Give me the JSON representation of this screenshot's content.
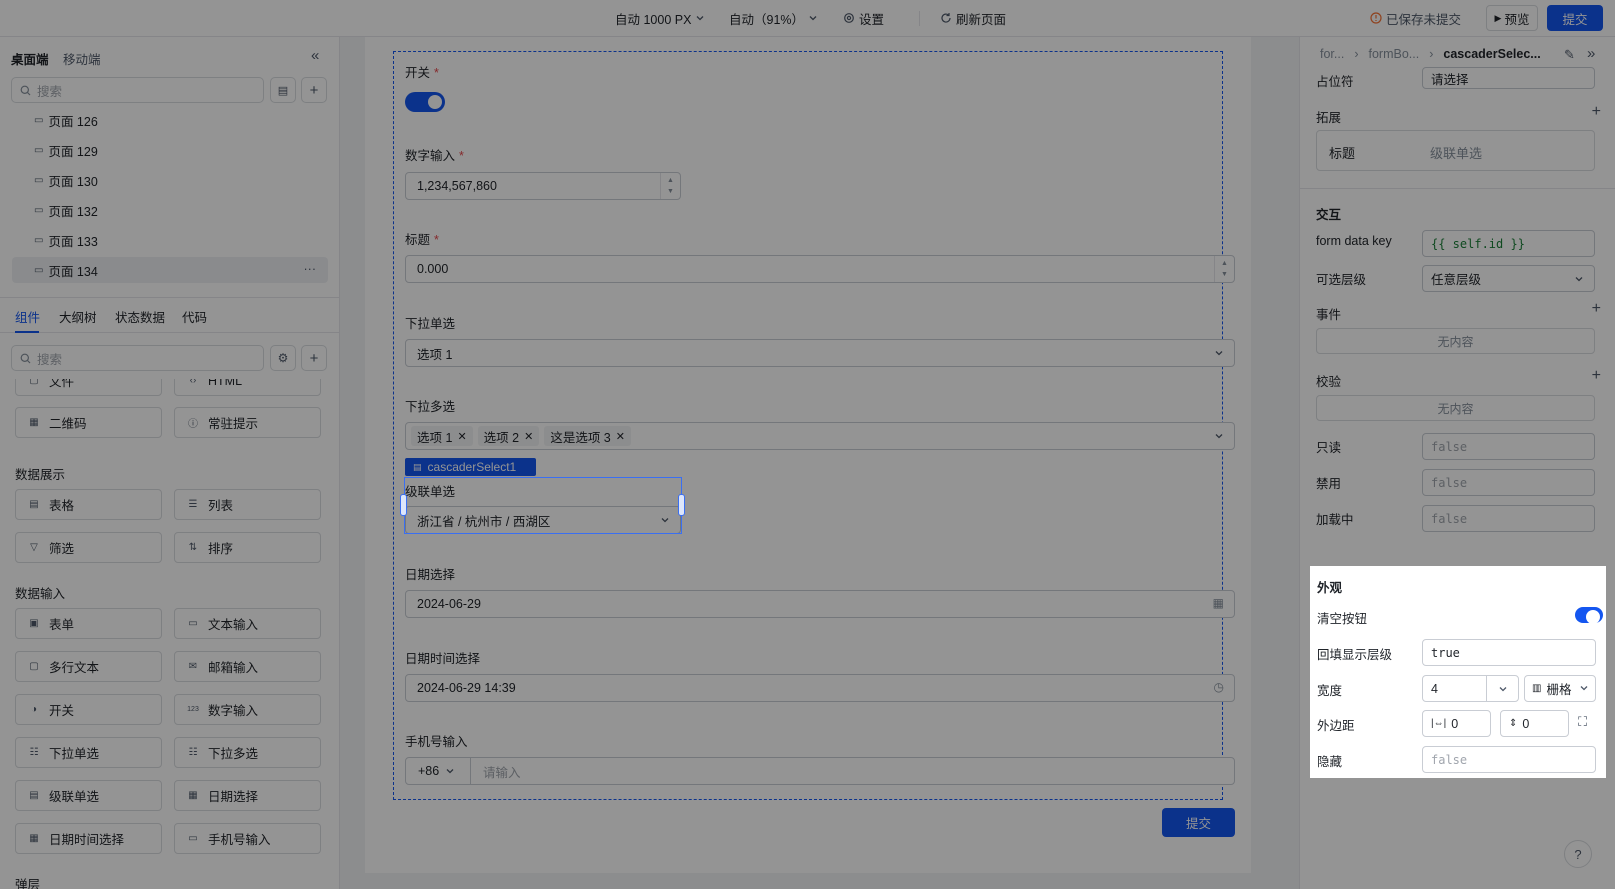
{
  "topbar": {
    "width_label": "自动 1000 PX",
    "zoom_label": "自动（91%）",
    "settings_label": "设置",
    "refresh_label": "刷新页面",
    "unsaved_label": "已保存未提交",
    "preview_label": "预览",
    "submit_label": "提交"
  },
  "left": {
    "tabs_top": [
      "桌面端",
      "移动端"
    ],
    "search_placeholder": "搜索",
    "pages": [
      "页面 126",
      "页面 129",
      "页面 130",
      "页面 132",
      "页面 133",
      "页面 134"
    ],
    "selected_page_more": "···",
    "tabs_bottom": [
      "组件",
      "大纲树",
      "状态数据",
      "代码"
    ],
    "comp_search_placeholder": "搜索",
    "cut_row": [
      "文件",
      "HTML"
    ],
    "row_qr": [
      "二维码",
      "常驻提示"
    ],
    "section_display": "数据展示",
    "display_items": [
      "表格",
      "列表",
      "筛选",
      "排序"
    ],
    "section_input": "数据输入",
    "input_items": [
      "表单",
      "文本输入",
      "多行文本",
      "邮箱输入",
      "开关",
      "数字输入",
      "下拉单选",
      "下拉多选",
      "级联单选",
      "日期选择",
      "日期时间选择",
      "手机号输入"
    ],
    "section_layer": "弹层"
  },
  "form": {
    "switch_label": "开关",
    "number_label": "数字输入",
    "number_value": "1,234,567,860",
    "title_label": "标题",
    "title_value": "0.000",
    "select_label": "下拉单选",
    "select_value": "选项 1",
    "multi_label": "下拉多选",
    "multi_tags": [
      "选项 1",
      "选项 2",
      "这是选项 3"
    ],
    "cascader_chip": "cascaderSelect1",
    "cascader_label": "级联单选",
    "cascader_value": "浙江省 / 杭州市 / 西湖区",
    "date_label": "日期选择",
    "date_value": "2024-06-29",
    "datetime_label": "日期时间选择",
    "datetime_value": "2024-06-29 14:39",
    "phone_label": "手机号输入",
    "phone_code": "+86",
    "phone_placeholder": "请输入",
    "submit_label": "提交"
  },
  "right": {
    "breadcrumb": [
      "for...",
      "formBo...",
      "cascaderSelec..."
    ],
    "placeholder_label": "占位符",
    "placeholder_value": "请选择",
    "ext_label": "拓展",
    "ext_title_label": "标题",
    "ext_title_value": "级联单选",
    "interaction_label": "交互",
    "form_key_label": "form data key",
    "form_key_value": "{{ self.id }}",
    "level_label": "可选层级",
    "level_value": "任意层级",
    "event_label": "事件",
    "event_empty": "无内容",
    "validate_label": "校验",
    "validate_empty": "无内容",
    "readonly_label": "只读",
    "readonly_value": "false",
    "disabled_label": "禁用",
    "disabled_value": "false",
    "loading_label": "加载中",
    "loading_value": "false",
    "appearance_label": "外观",
    "clear_label": "清空按钮",
    "backfill_label": "回填显示层级",
    "backfill_value": "true",
    "width_label": "宽度",
    "width_value": "4",
    "width_unit": "栅格",
    "margin_label": "外边距",
    "margin_h": "0",
    "margin_v": "0",
    "hidden_label": "隐藏",
    "hidden_value": "false",
    "help_icon": "?"
  }
}
